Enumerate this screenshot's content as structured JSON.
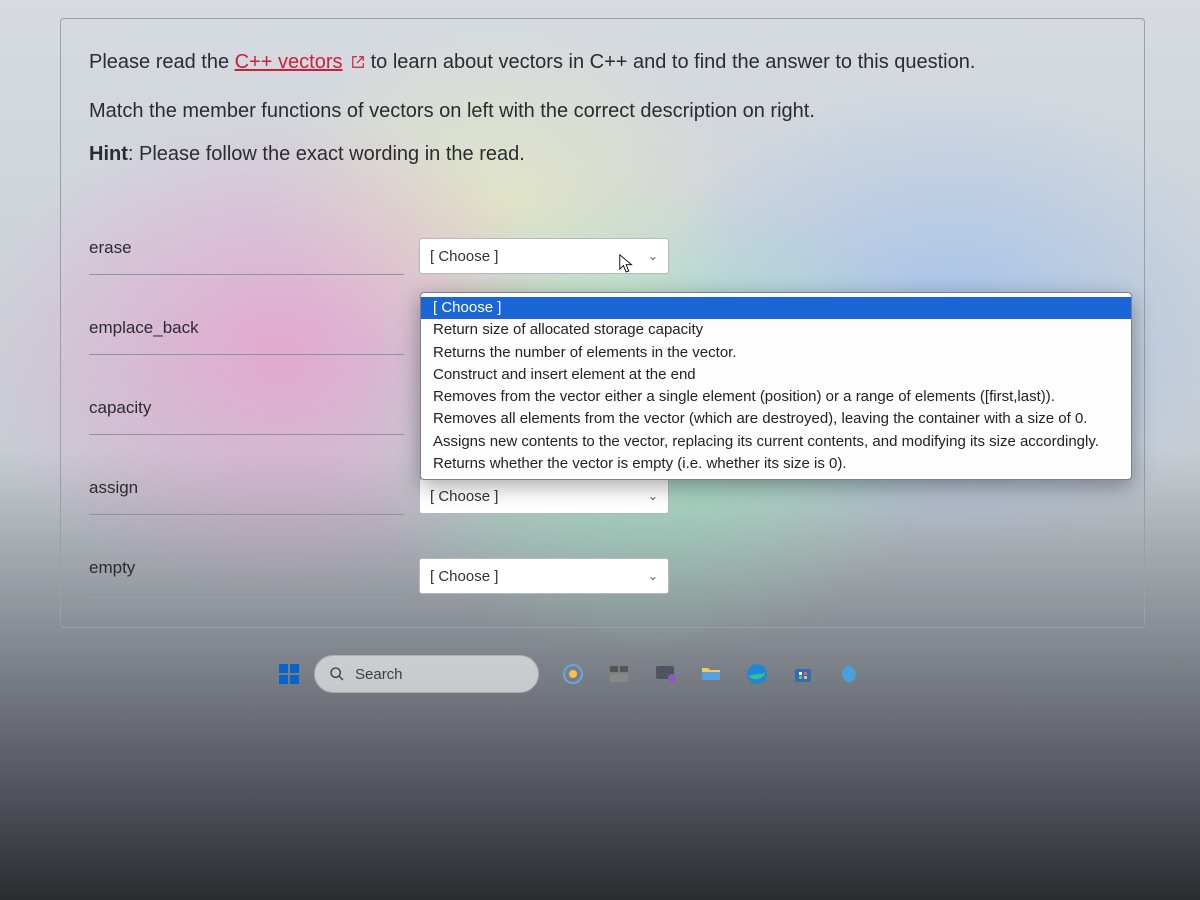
{
  "question": {
    "intro_before_link": "Please read the ",
    "link_text": "C++ vectors",
    "intro_after_link": "to learn about vectors in C++ and to find the answer to this question.",
    "instruction": "Match the member functions of vectors on left with the correct description on right.",
    "hint_label": "Hint",
    "hint_text": ": Please follow the exact wording in the read."
  },
  "match": {
    "placeholder": "[ Choose ]",
    "items": [
      {
        "label": "erase"
      },
      {
        "label": "emplace_back"
      },
      {
        "label": "capacity"
      },
      {
        "label": "assign"
      },
      {
        "label": "empty"
      }
    ]
  },
  "dropdown": {
    "options": [
      "[ Choose ]",
      "Return size of allocated storage capacity",
      "Returns the number of elements in the vector.",
      "Construct and insert element at the end",
      "Removes from the vector either a single element (position) or a range of elements ([first,last)).",
      "Removes all elements from the vector (which are destroyed), leaving the container with a size of 0.",
      "Assigns new contents to the vector, replacing its current contents, and modifying its size accordingly.",
      "Returns whether the vector is empty (i.e. whether its size is 0)."
    ],
    "selected_index": 0
  },
  "taskbar": {
    "search_placeholder": "Search"
  }
}
